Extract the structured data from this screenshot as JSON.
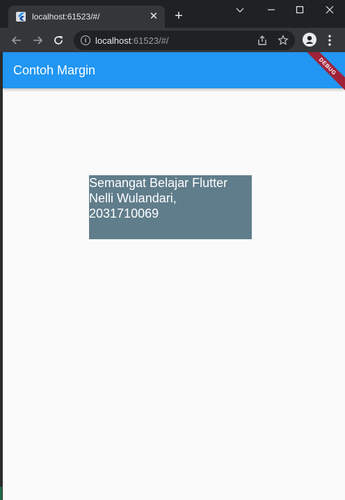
{
  "browser": {
    "tab_title": "localhost:61523/#/",
    "url_host": "localhost",
    "url_rest": ":61523/#/"
  },
  "app": {
    "appbar_title": "Contoh Margin",
    "debug_banner": "DEBUG",
    "appbar_color": "#2196f3",
    "box_color": "#607d8b",
    "box_lines": [
      "Semangat Belajar Flutter",
      "Nelli Wulandari,",
      "2031710069"
    ]
  },
  "icons": {
    "tab_favicon": "flutter-icon",
    "tab_close": "close-icon",
    "new_tab": "plus-icon",
    "window_controls": [
      "chevron-down-icon",
      "minimize-icon",
      "maximize-icon",
      "close-icon"
    ],
    "nav": [
      "back-arrow-icon",
      "forward-arrow-icon",
      "reload-icon"
    ],
    "omnibox": [
      "info-icon",
      "share-icon",
      "star-icon"
    ],
    "profile": "person-icon",
    "menu": "kebab-menu-icon"
  }
}
